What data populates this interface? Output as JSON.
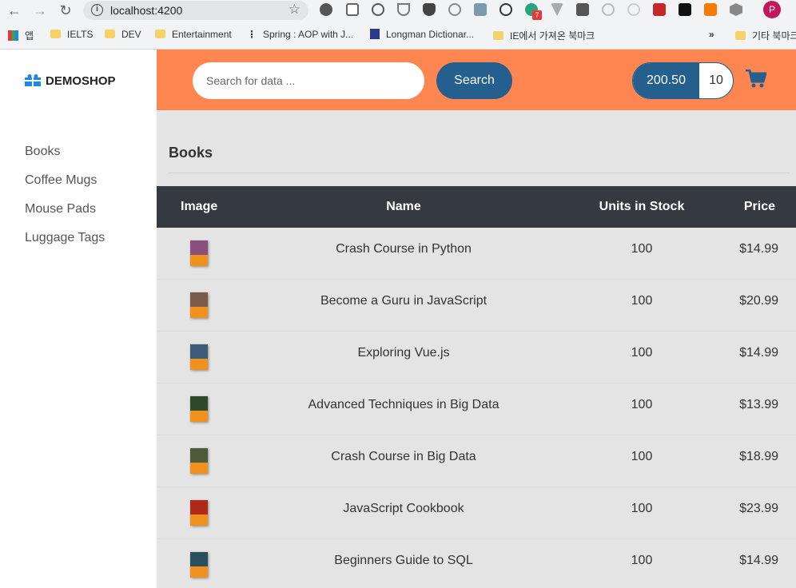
{
  "browser": {
    "url": "localhost:4200",
    "bookmarks": [
      {
        "label": "앱"
      },
      {
        "label": "IELTS"
      },
      {
        "label": "DEV"
      },
      {
        "label": "Entertainment"
      },
      {
        "label": "Spring : AOP with J..."
      },
      {
        "label": "Longman Dictionar..."
      },
      {
        "label": "IE에서 가져온 북마크"
      },
      {
        "label": "기타 북마크"
      }
    ],
    "more_label": "»",
    "profile_initial": "P",
    "ext_badge": "7"
  },
  "brand": {
    "name": "DEMOSHOP"
  },
  "search": {
    "placeholder": "Search for data ...",
    "button_label": "Search"
  },
  "cart": {
    "total": "200.50",
    "quantity": "10"
  },
  "sidebar": {
    "items": [
      {
        "label": "Books"
      },
      {
        "label": "Coffee Mugs"
      },
      {
        "label": "Mouse Pads"
      },
      {
        "label": "Luggage Tags"
      }
    ]
  },
  "main": {
    "category_title": "Books",
    "columns": [
      "Image",
      "Name",
      "Units in Stock",
      "Price"
    ],
    "products": [
      {
        "name": "Crash Course in Python",
        "stock": "100",
        "price": "$14.99",
        "thumb_color": "#8a4f7d"
      },
      {
        "name": "Become a Guru in JavaScript",
        "stock": "100",
        "price": "$20.99",
        "thumb_color": "#7a5a48"
      },
      {
        "name": "Exploring Vue.js",
        "stock": "100",
        "price": "$14.99",
        "thumb_color": "#3d5a7a"
      },
      {
        "name": "Advanced Techniques in Big Data",
        "stock": "100",
        "price": "$13.99",
        "thumb_color": "#2f4a2a"
      },
      {
        "name": "Crash Course in Big Data",
        "stock": "100",
        "price": "$18.99",
        "thumb_color": "#4a5a3a"
      },
      {
        "name": "JavaScript Cookbook",
        "stock": "100",
        "price": "$23.99",
        "thumb_color": "#b02a1a"
      },
      {
        "name": "Beginners Guide to SQL",
        "stock": "100",
        "price": "$14.99",
        "thumb_color": "#2a4f5a"
      }
    ]
  },
  "colors": {
    "topbar": "#ff8551",
    "primary": "#245f8e",
    "table_header": "#343a40",
    "main_bg": "#e4e4e4"
  }
}
